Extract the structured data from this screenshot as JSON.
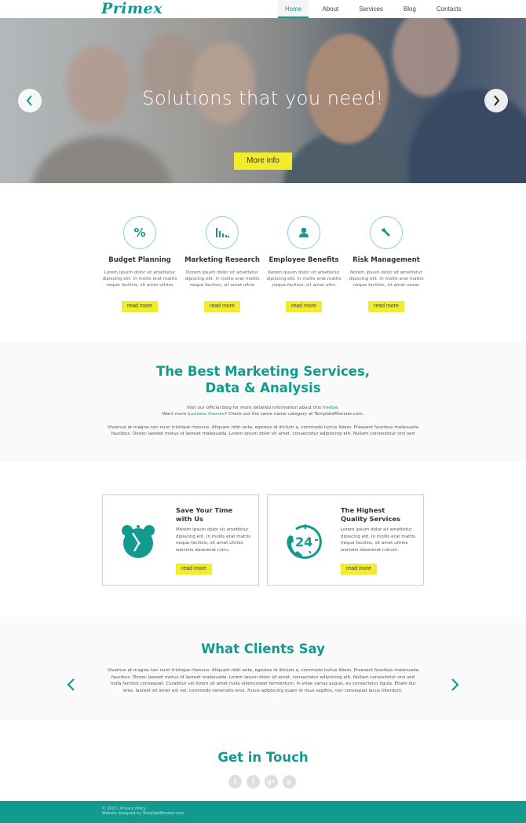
{
  "header": {
    "logo": "Primex",
    "nav": [
      {
        "label": "Home",
        "active": true
      },
      {
        "label": "About",
        "active": false
      },
      {
        "label": "Services",
        "active": false
      },
      {
        "label": "Blog",
        "active": false
      },
      {
        "label": "Contacts",
        "active": false
      }
    ]
  },
  "hero": {
    "title": "Solutions that you need!",
    "button": "More info",
    "prev_icon": "chevron-left-icon",
    "next_icon": "chevron-right-icon"
  },
  "services": [
    {
      "icon": "percent-icon",
      "title": "Budget Planning",
      "text": "Lorem ipsum dolor sit amettetur dipiscing elit. In mollis erat mattis neque facilisis, sit amet ultries",
      "button": "read more"
    },
    {
      "icon": "bar-chart-icon",
      "title": "Marketing Research",
      "text": "Dorem ipsum dolor sit amettetur dipiscing elit. In mollis erat mattis neque facilisis, sit amet ultrie",
      "button": "read more"
    },
    {
      "icon": "user-icon",
      "title": "Employee Benefits",
      "text": "Kerem ipsum dolor sit amettetur dipiscing elit. In mollis erat mattis neque facilisis, sit amet ultrs",
      "button": "read more"
    },
    {
      "icon": "wrench-icon",
      "title": "Risk Management",
      "text": "Norem ipsum dolor sit amettetur dipiscing elit. In mollis erat mattis neque facilisis, sit amet uesas",
      "button": "read more"
    }
  ],
  "marketing": {
    "title_line1": "The Best Marketing Services,",
    "title_line2": "Data & Analysis",
    "sub1_pre": "Visit our official blog for more detailed information about this ",
    "sub1_link": "freebie",
    "sub1_post": ".",
    "sub2_pre": "Want more ",
    "sub2_link": "business themes",
    "sub2_post": "? Check out the same name category at TemplateMonster.com.",
    "body": "Vivamus at magna non nunc tristique rhoncus. Aliquam nibh ante, egestas id dictum a, commodo luctus libero. Praesent faucibus malesuada faucibus. Donec laoreet metus id laoreet malesuada. Lorem ipsum dolor sit amet, consectetur adipiscing elit. Nullam consectetur orci sed"
  },
  "features": [
    {
      "icon": "alarm-clock-icon",
      "title_line1": "Save Your Time",
      "title_line2": "with Us",
      "text": "Morem ipsum dolor sit amettetur dipiscing elit. In mollis erat mattis neque facilisis, sit amet ultries wertolio dasererat rutru.",
      "button": "read more"
    },
    {
      "icon": "phone-24-icon",
      "title_line1": "The Highest",
      "title_line2": "Quality Services",
      "text": "Lorem ipsum dolor sit amettetur dipiscing elit. In mollis erat mattis neque facilisis, sit amet ultries wertolio dasererat rutrum.",
      "button": "read more"
    }
  ],
  "clients": {
    "title": "What Clients Say",
    "text": "Vivamus at magna non nunc tristique rhoncus. Aliquam nibh ante, egestas id dictum a, commodo luctus libero. Praesent faucibus malesuada faucibus. Donec laoreet metus id laoreet malesuada. Lorem ipsum dolor sit amet, consectetur adipiscing elit. Nullam consectetur orci sed nulla facilisis consequat. Curabitur vel lorem sit amet nulla ullamcorper fermentum. In vitae varius augue, eu consectetur ligula. Etiam dui eros, laoreet sit amet est vel, commodo venenatis eros. Fusce adipiscing quam id risus sagittis, non consequat lacus interdum."
  },
  "contact": {
    "title": "Get in Touch",
    "socials": [
      {
        "name": "twitter-icon",
        "glyph": "t"
      },
      {
        "name": "facebook-icon",
        "glyph": "f"
      },
      {
        "name": "google-plus-icon",
        "glyph": "g+"
      },
      {
        "name": "pinterest-icon",
        "glyph": "p"
      }
    ]
  },
  "footer": {
    "line1": "© 2013 | Privacy Policy",
    "line2": "Website designed by TemplateMonster.com"
  },
  "colors": {
    "accent": "#139a8f",
    "button_yellow": "#f2ec2c",
    "footer_bg": "#139a8f"
  }
}
